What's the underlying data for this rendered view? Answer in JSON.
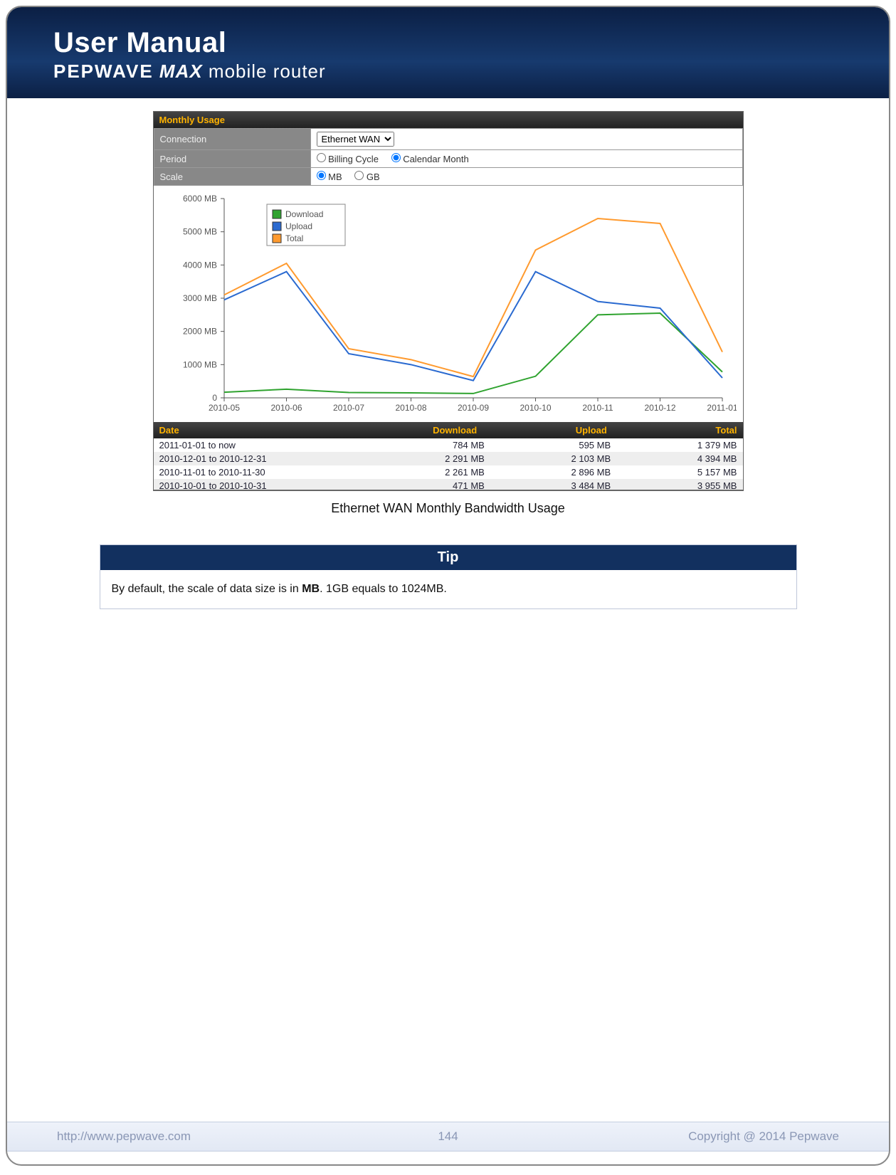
{
  "header": {
    "title_main": "User Manual",
    "brand": "PEPWAVE",
    "max": "MAX",
    "suffix": "mobile router"
  },
  "panel": {
    "section_title": "Monthly Usage",
    "rows": {
      "connection": {
        "label": "Connection",
        "selected": "Ethernet WAN"
      },
      "period": {
        "label": "Period",
        "opt1": "Billing Cycle",
        "opt2": "Calendar Month",
        "selected": "Calendar Month"
      },
      "scale": {
        "label": "Scale",
        "opt1": "MB",
        "opt2": "GB",
        "selected": "MB"
      }
    }
  },
  "chart_data": {
    "type": "line",
    "xlabel": "",
    "ylabel": "",
    "ylim": [
      0,
      6000
    ],
    "yticks": [
      0,
      1000,
      2000,
      3000,
      4000,
      5000,
      6000
    ],
    "ytick_labels": [
      "0",
      "1000 MB",
      "2000 MB",
      "3000 MB",
      "4000 MB",
      "5000 MB",
      "6000 MB"
    ],
    "categories": [
      "2010-05",
      "2010-06",
      "2010-07",
      "2010-08",
      "2010-09",
      "2010-10",
      "2010-11",
      "2010-12",
      "2011-01"
    ],
    "legend": [
      "Download",
      "Upload",
      "Total"
    ],
    "series": [
      {
        "name": "Download",
        "color": "#2fa32f",
        "values": [
          170,
          260,
          160,
          150,
          130,
          650,
          2500,
          2550,
          780
        ]
      },
      {
        "name": "Upload",
        "color": "#2a6ad0",
        "values": [
          2950,
          3800,
          1330,
          1000,
          520,
          3800,
          2900,
          2700,
          600
        ]
      },
      {
        "name": "Total",
        "color": "#ff9a2e",
        "values": [
          3100,
          4050,
          1480,
          1150,
          640,
          4450,
          5400,
          5250,
          1380
        ]
      }
    ]
  },
  "table": {
    "headers": {
      "date": "Date",
      "download": "Download",
      "upload": "Upload",
      "total": "Total"
    },
    "rows": [
      {
        "date": "2011-01-01 to now",
        "download": "784 MB",
        "upload": "595 MB",
        "total": "1 379 MB"
      },
      {
        "date": "2010-12-01 to 2010-12-31",
        "download": "2 291 MB",
        "upload": "2 103 MB",
        "total": "4 394 MB"
      },
      {
        "date": "2010-11-01 to 2010-11-30",
        "download": "2 261 MB",
        "upload": "2 896 MB",
        "total": "5 157 MB"
      },
      {
        "date": "2010-10-01 to 2010-10-31",
        "download": "471 MB",
        "upload": "3 484 MB",
        "total": "3 955 MB"
      }
    ]
  },
  "caption": "Ethernet WAN Monthly Bandwidth Usage",
  "tip": {
    "title": "Tip",
    "body_pre": "By default, the scale of data size is in ",
    "body_bold": "MB",
    "body_post": ". 1GB equals to 1024MB."
  },
  "footer": {
    "url": "http://www.pepwave.com",
    "page": "144",
    "copyright": "Copyright @ 2014 Pepwave"
  }
}
